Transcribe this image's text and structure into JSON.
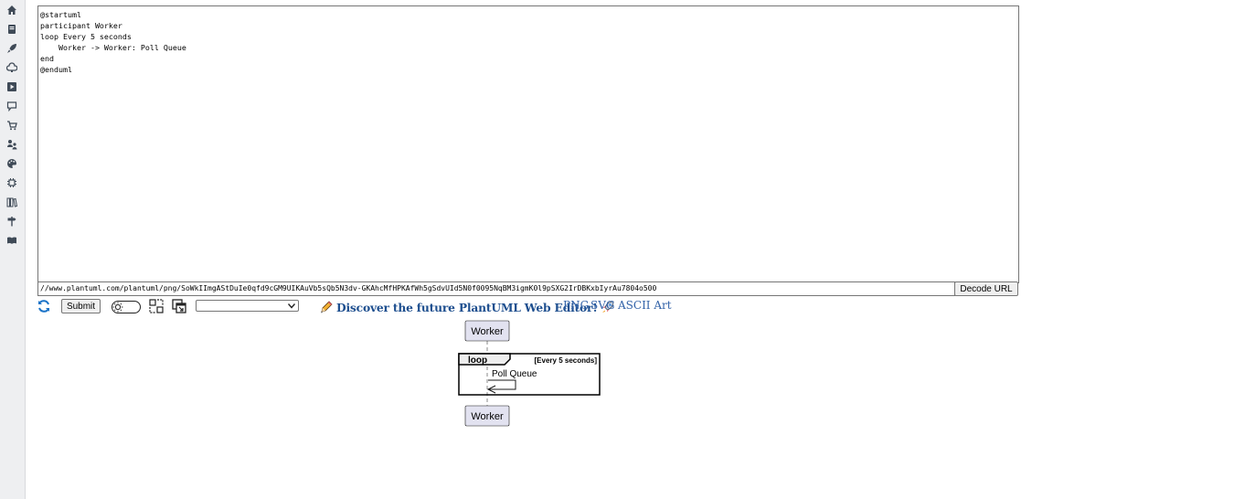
{
  "sidebar": {
    "icons": [
      "home-icon",
      "book-icon",
      "rocket-icon",
      "cloud-icon",
      "play-icon",
      "chat-icon",
      "cart-icon",
      "users-icon",
      "palette-icon",
      "chip-icon",
      "library-icon",
      "signpost-icon",
      "open-book-icon"
    ]
  },
  "editor": {
    "source": "@startuml\nparticipant Worker\nloop Every 5 seconds\n    Worker -> Worker: Poll Queue\nend\n@enduml"
  },
  "url_bar": {
    "value": "//www.plantuml.com/plantuml/png/SoWkIImgAStDuIe0qfd9cGM9UIKAuVb5sQb5N3dv-GKAhcMfHPKAfWh5gSdvUId5N0f0095NqBM3igmK0l9pSXG2IrDBKxbIyrAu7804o500",
    "decode_label": "Decode URL"
  },
  "toolbar": {
    "submit_label": "Submit",
    "select_value": "",
    "discover_text": "Discover the future PlantUML Web Editor!",
    "links": [
      "PNG",
      "SVG",
      "ASCII Art"
    ]
  },
  "diagram": {
    "participant_top": "Worker",
    "participant_bottom": "Worker",
    "loop_keyword": "loop",
    "loop_condition": "[Every 5 seconds]",
    "message": "Poll Queue"
  },
  "colors": {
    "sidebar_bg": "#eeeff1",
    "link": "#3262a8",
    "participant_fill": "#e2e2f0",
    "refresh": "#1a73c8"
  }
}
